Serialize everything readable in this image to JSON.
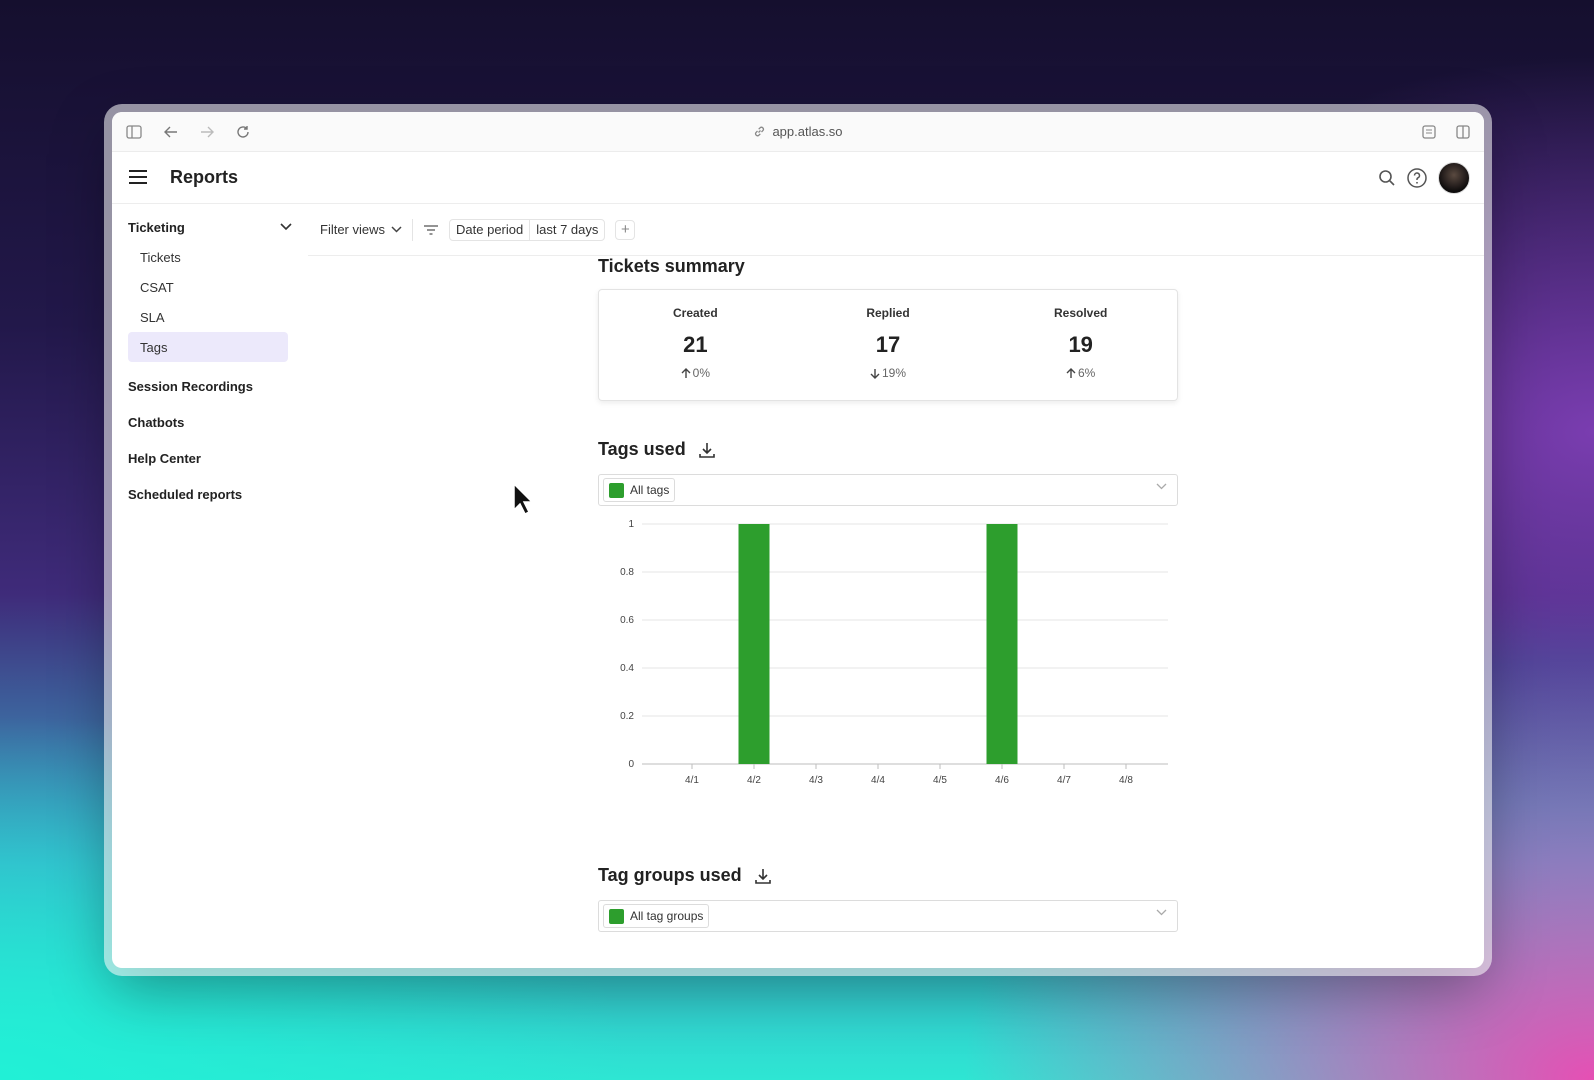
{
  "browser": {
    "url": "app.atlas.so"
  },
  "app": {
    "title": "Reports"
  },
  "sidebar": {
    "group": "Ticketing",
    "items": [
      "Tickets",
      "CSAT",
      "SLA",
      "Tags"
    ],
    "active": "Tags",
    "sections": [
      "Session Recordings",
      "Chatbots",
      "Help Center",
      "Scheduled reports"
    ]
  },
  "toolbar": {
    "filter_views": "Filter views",
    "date_label": "Date period",
    "date_value": "last 7 days",
    "add": "+"
  },
  "summary": {
    "title": "Tickets summary",
    "stats": [
      {
        "label": "Created",
        "value": "21",
        "change": "0%",
        "direction": "up"
      },
      {
        "label": "Replied",
        "value": "17",
        "change": "19%",
        "direction": "down"
      },
      {
        "label": "Resolved",
        "value": "19",
        "change": "6%",
        "direction": "up"
      }
    ]
  },
  "tags_used": {
    "title": "Tags used",
    "filter": "All tags"
  },
  "tag_groups_used": {
    "title": "Tag groups used",
    "filter": "All tag groups"
  },
  "colors": {
    "bar": "#2d9e2d",
    "active_bg": "#ece9fb"
  },
  "chart_data": {
    "type": "bar",
    "categories": [
      "4/1",
      "4/2",
      "4/3",
      "4/4",
      "4/5",
      "4/6",
      "4/7",
      "4/8"
    ],
    "values": [
      0,
      1,
      0,
      0,
      0,
      1,
      0,
      0
    ],
    "yticks": [
      "0",
      "0.2",
      "0.4",
      "0.6",
      "0.8",
      "1"
    ],
    "ylim": [
      0,
      1
    ],
    "grid": true,
    "title": "",
    "xlabel": "",
    "ylabel": ""
  }
}
